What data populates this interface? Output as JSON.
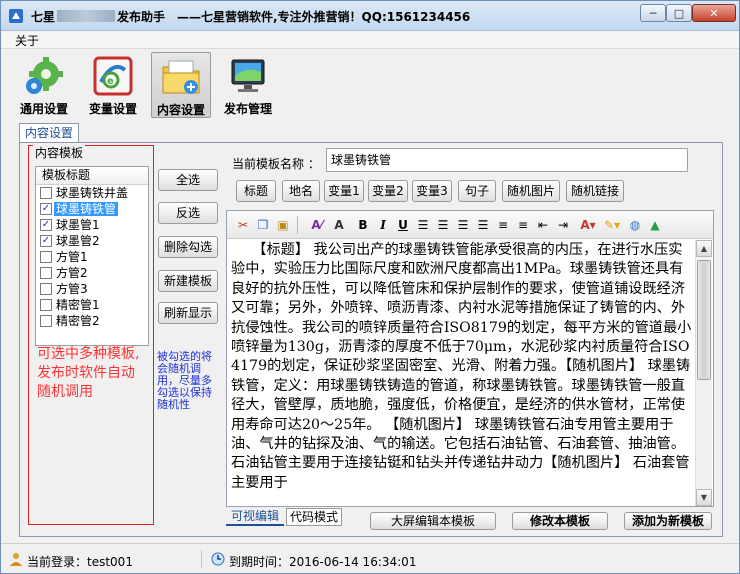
{
  "window": {
    "title_prefix": "七星",
    "title_suffix": "发布助手",
    "slogan": "——七星营销软件,专注外推营销！QQ:1561234456",
    "minimize": "─",
    "maximize": "□",
    "close": "✕"
  },
  "menu": {
    "about": "关于"
  },
  "toolbar": [
    {
      "label": "通用设置",
      "icon": "gears-icon"
    },
    {
      "label": "变量设置",
      "icon": "variable-icon"
    },
    {
      "label": "内容设置",
      "icon": "content-folder-icon"
    },
    {
      "label": "发布管理",
      "icon": "monitor-icon"
    }
  ],
  "tab": {
    "label": "内容设置"
  },
  "template_group": {
    "title": "内容模板",
    "list_header": "模板标题",
    "items": [
      {
        "label": "球墨铸铁井盖",
        "checked": false,
        "selected": false
      },
      {
        "label": "球墨铸铁管",
        "checked": true,
        "selected": true
      },
      {
        "label": "球墨管1",
        "checked": true,
        "selected": false
      },
      {
        "label": "球墨管2",
        "checked": true,
        "selected": false
      },
      {
        "label": "方管1",
        "checked": false,
        "selected": false
      },
      {
        "label": "方管2",
        "checked": false,
        "selected": false
      },
      {
        "label": "方管3",
        "checked": false,
        "selected": false
      },
      {
        "label": "精密管1",
        "checked": false,
        "selected": false
      },
      {
        "label": "精密管2",
        "checked": false,
        "selected": false
      }
    ],
    "hint": "可选中多种模板,发布时软件自动随机调用"
  },
  "side_buttons": {
    "select_all": "全选",
    "invert": "反选",
    "delete_checked": "删除勾选",
    "new_template": "新建模板",
    "refresh": "刷新显示"
  },
  "side_hint": "被勾选的将会随机调用，尽量多勾选以保持随机性",
  "editor": {
    "name_label": "当前模板名称 ：",
    "name_value": "球墨铸铁管",
    "insert_buttons": [
      "标题",
      "地名",
      "变量1",
      "变量2",
      "变量3",
      "句子",
      "随机图片",
      "随机链接"
    ],
    "text": "　　【标题】 我公司出产的球墨铸铁管能承受很高的内压，在进行水压实验中，实验压力比国际尺度和欧洲尺度都高出1MPa。球墨铸铁管还具有良好的抗外压性，可以降低管床和保护层制作的要求，使管道铺设既经济又可靠；另外，外喷锌、喷沥青漆、内衬水泥等措施保证了铸管的内、外抗侵蚀性。我公司的喷锌质量符合ISO8179的划定，每平方米的管道最小喷锌量为130g，沥青漆的厚度不低于70μm，水泥砂浆内衬质量符合ISO4179的划定，保证砂浆坚固密室、光滑、附着力强。【随机图片】 球墨铸铁管，定义：用球墨铸铁铸造的管道，称球墨铸铁管。球墨铸铁管一般直径大，管壁厚，质地脆，强度低，价格便宜，是经济的供水管材，正常使用寿命可达20～25年。 【随机图片】 球墨铸铁管石油专用管主要用于油、气井的钻探及油、气的输送。它包括石油钻管、石油套管、抽油管。石油钻管主要用于连接钻铤和钻头并传递钻井动力【随机图片】 石油套管主要用于",
    "mode_visual": "可视编辑",
    "mode_code": "代码模式",
    "btn_fullscreen": "大屏编辑本模板",
    "btn_modify": "修改本模板",
    "btn_add_new": "添加为新模板"
  },
  "status": {
    "login": "当前登录：test001",
    "expiry": "到期时间：2016-06-14 16:34:01"
  },
  "colors": {
    "accent": "#1f4f96",
    "selection": "#3399ff",
    "hint_red": "#ff3333",
    "hint_blue": "#1f2fd6"
  }
}
